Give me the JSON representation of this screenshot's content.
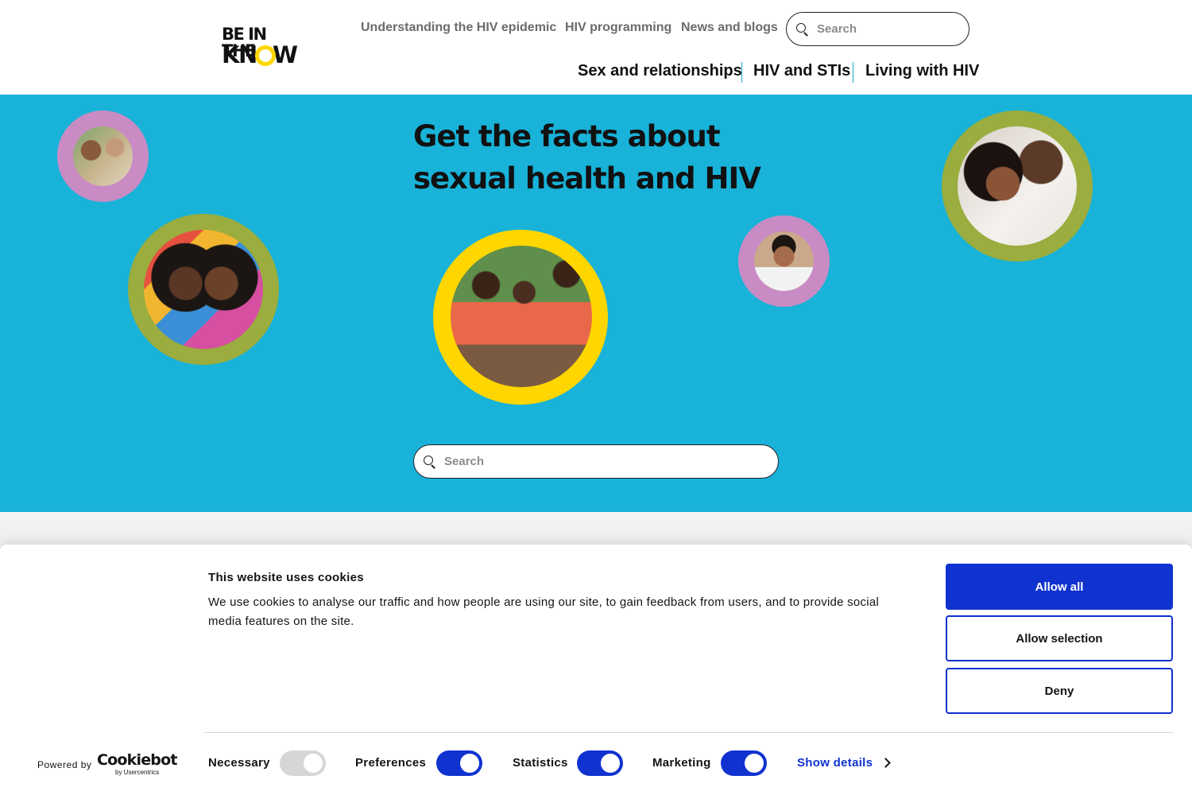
{
  "logo": {
    "line1": "BE IN THE",
    "line2_start": "KN",
    "line2_end": "W"
  },
  "top_nav": [
    {
      "label": "Understanding the HIV epidemic"
    },
    {
      "label": "HIV programming"
    },
    {
      "label": "News and blogs"
    }
  ],
  "header_search": {
    "placeholder": "Search"
  },
  "main_nav": [
    {
      "label": "Sex and relationships"
    },
    {
      "label": "HIV and STIs"
    },
    {
      "label": "Living with HIV"
    }
  ],
  "hero": {
    "title": "Get the facts about sexual health and HIV",
    "search_placeholder": "Search"
  },
  "colors": {
    "hero_bg": "#19b2d8",
    "ring_pink": "#c98bc4",
    "ring_green": "#9aad3e",
    "ring_yellow": "#ffd600",
    "brand_blue": "#1032cf"
  },
  "cookie_banner": {
    "title": "This website uses cookies",
    "text": "We use cookies to analyse our traffic and how people are using our site, to gain feedback from users, and to provide social media features on the site.",
    "buttons": {
      "allow_all": "Allow all",
      "allow_selection": "Allow selection",
      "deny": "Deny"
    },
    "powered_by": "Powered by",
    "brand": "Cookiebot",
    "brand_sub": "by Usercentrics",
    "toggles": [
      {
        "label": "Necessary",
        "checked": true,
        "disabled": true
      },
      {
        "label": "Preferences",
        "checked": true,
        "disabled": false
      },
      {
        "label": "Statistics",
        "checked": true,
        "disabled": false
      },
      {
        "label": "Marketing",
        "checked": true,
        "disabled": false
      }
    ],
    "show_details": "Show details"
  }
}
